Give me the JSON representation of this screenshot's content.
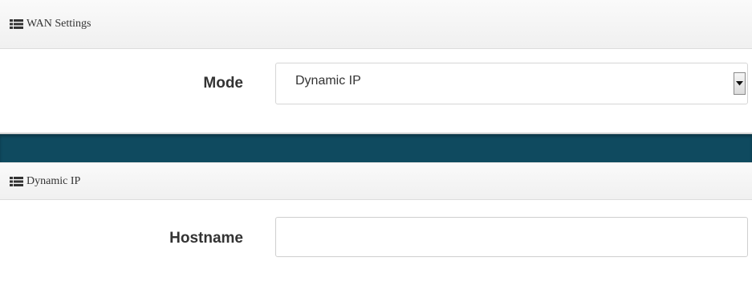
{
  "wan_settings": {
    "title": "WAN Settings",
    "icon": "list-icon",
    "mode": {
      "label": "Mode",
      "selected_value": "Dynamic IP"
    }
  },
  "dynamic_ip": {
    "title": "Dynamic IP",
    "icon": "list-icon",
    "hostname": {
      "label": "Hostname",
      "value": ""
    }
  },
  "colors": {
    "divider_band": "#0f4a5f",
    "header_bg": "#f2f2f2",
    "label_text": "#333333"
  }
}
